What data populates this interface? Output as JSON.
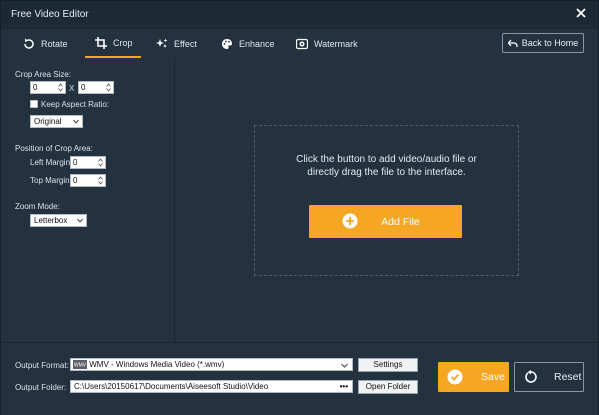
{
  "window": {
    "title": "Free Video Editor",
    "close_icon": "close-icon"
  },
  "tabs": [
    {
      "label": "Rotate",
      "icon": "rotate-icon"
    },
    {
      "label": "Crop",
      "icon": "crop-icon"
    },
    {
      "label": "Effect",
      "icon": "effect-sparkles-icon"
    },
    {
      "label": "Enhance",
      "icon": "palette-icon"
    },
    {
      "label": "Watermark",
      "icon": "watermark-icon"
    }
  ],
  "header": {
    "back_label": "Back to Home",
    "back_icon": "back-arrow-icon"
  },
  "crop": {
    "area_label": "Crop Area Size:",
    "width_value": "0",
    "height_value": "0",
    "x_symbol": "X",
    "keep_aspect_label": "Keep Aspect Ratio:",
    "aspect_value": "Original",
    "position_label": "Position of Crop Area:",
    "left_margin_label": "Left Margin:",
    "left_margin_value": "0",
    "top_margin_label": "Top Margin:",
    "top_margin_value": "0",
    "zoom_label": "Zoom Mode:",
    "zoom_value": "Letterbox"
  },
  "main": {
    "hint_line1": "Click the button to add video/audio file or",
    "hint_line2": "directly drag the file to the interface.",
    "add_file_label": "Add File",
    "add_icon": "plus-circle-icon"
  },
  "output": {
    "format_label": "Output Format:",
    "format_value": "WMV - Windows Media Video (*.wmv)",
    "settings_label": "Settings",
    "folder_label": "Output Folder:",
    "folder_value": "C:\\Users\\20150617\\Documents\\Aiseesoft Studio\\Video",
    "folder_browse": "•••",
    "open_folder_label": "Open Folder"
  },
  "actions": {
    "save_label": "Save",
    "reset_label": "Reset"
  },
  "colors": {
    "accent": "#f5a623",
    "bg": "#243240"
  }
}
